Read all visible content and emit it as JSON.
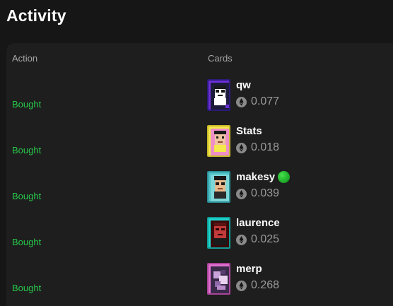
{
  "header": {
    "title": "Activity"
  },
  "table": {
    "columns": {
      "action": "Action",
      "cards": "Cards"
    },
    "rows": [
      {
        "action": "Bought",
        "name": "qw",
        "price": "0.077",
        "card_color": "#6b2fd6",
        "verified": false
      },
      {
        "action": "Bought",
        "name": "Stats",
        "price": "0.018",
        "card_color": "#f4e84a",
        "verified": false
      },
      {
        "action": "Bought",
        "name": "makesy",
        "price": "0.039",
        "card_color": "#4fc3c9",
        "verified": true
      },
      {
        "action": "Bought",
        "name": "laurence",
        "price": "0.025",
        "card_color": "#1fd8d0",
        "verified": false
      },
      {
        "action": "Bought",
        "name": "merp",
        "price": "0.268",
        "card_color": "#e06fd0",
        "verified": false
      }
    ]
  },
  "icons": {
    "price": "eth-icon",
    "verified": "verified-badge-icon"
  },
  "colors": {
    "accent_action": "#27c84a",
    "background": "#161616",
    "panel": "#1e1e1e"
  }
}
